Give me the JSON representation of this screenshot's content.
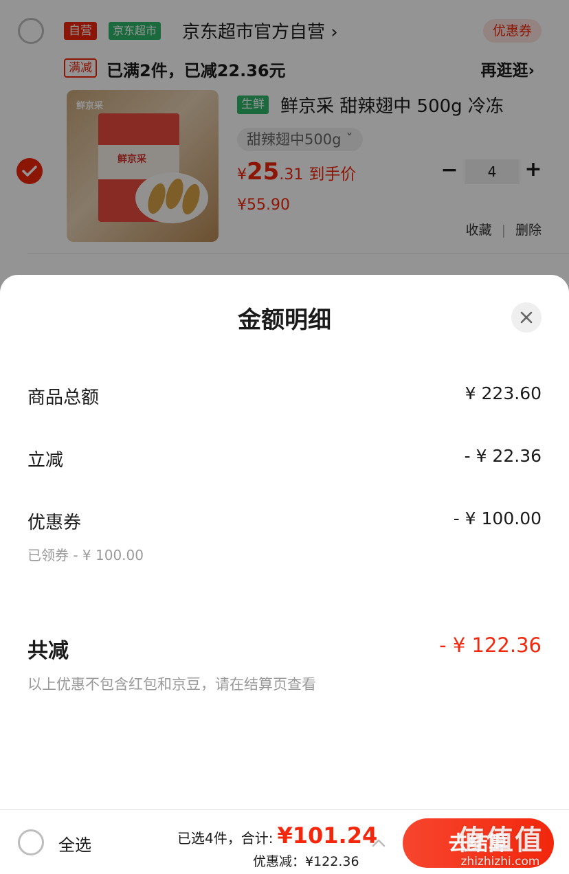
{
  "cart": {
    "shop": {
      "self_tag": "自营",
      "supermarket_tag": "京东超市",
      "name": "京东超市官方自营 ›",
      "coupon_label": "优惠券"
    },
    "promo": {
      "tag": "满减",
      "text": "已满2件，已减22.36元",
      "link": "再逛逛›"
    },
    "item": {
      "checked": true,
      "image_brand": "鲜京采",
      "image_pack_label": "鲜京采",
      "fresh_tag": "生鲜",
      "title": "鲜京采 甜辣翅中 500g 冷冻",
      "spec": "甜辣翅中500g ˇ",
      "price_currency": "¥",
      "price_int": "25",
      "price_dec": ".31",
      "price_label": "到手价",
      "original_price": "¥55.90",
      "quantity": "4",
      "minus": "−",
      "plus": "+",
      "favorite": "收藏",
      "divider": "|",
      "delete": "删除"
    }
  },
  "sheet": {
    "title": "金额明细",
    "close_icon": "close-icon",
    "rows": [
      {
        "label": "商品总额",
        "value": "¥ 223.60"
      },
      {
        "label": "立减",
        "value": "- ¥ 22.36"
      },
      {
        "label": "优惠券",
        "value": "- ¥ 100.00",
        "sub": "已领券 - ¥ 100.00"
      }
    ],
    "total": {
      "label": "共减",
      "value": "- ¥ 122.36"
    },
    "note": "以上优惠不包含红包和京豆，请在结算页查看"
  },
  "bottom_bar": {
    "select_all": "全选",
    "selected_prefix": "已选4件，合计:",
    "total": "¥101.24",
    "discount": "优惠减：¥122.36",
    "checkout": "去结算"
  },
  "watermark": {
    "main": "值值值",
    "sub": "zhizhizhi.com"
  },
  "colors": {
    "accent": "#f2270c",
    "green": "#2eb76a",
    "muted": "#999999"
  }
}
